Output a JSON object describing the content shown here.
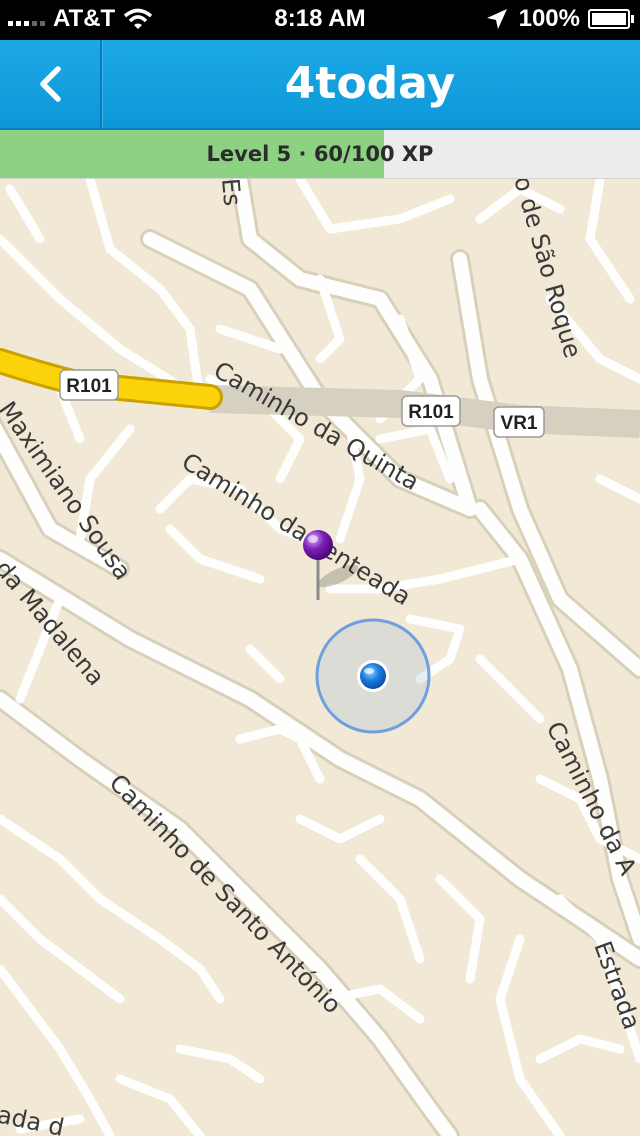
{
  "status_bar": {
    "carrier": "AT&T",
    "time": "8:18 AM",
    "battery": "100%",
    "battery_level": 1.0
  },
  "nav": {
    "title": "4today",
    "back_icon": "chevron-left-icon"
  },
  "xp": {
    "label": "Level 5 · 60/100 XP",
    "progress": 0.6
  },
  "map": {
    "shields": {
      "r101_left": "R101",
      "r101_right": "R101",
      "vr1": "VR1"
    },
    "streets": {
      "caminho_da_quinta": "Caminho da Quinta",
      "caminho_da_penteada": "Caminho da Penteada",
      "maximiano_sousa": "Maximiano Sousa",
      "madalena": "da Madalena",
      "caminho_de_santo_antonio": "Caminho de Santo António",
      "sao_roque": "o de São Roque",
      "caminho_da_a": "Caminho da A",
      "estrada": "Estrada",
      "es_top": "Es",
      "bottom_left": "ada d"
    },
    "colors": {
      "background": "#f1e9d5",
      "road": "#fefefc",
      "highway": "#fcd20b",
      "location": "#1b7fe0"
    },
    "pin_color": "#7a1fb5"
  }
}
